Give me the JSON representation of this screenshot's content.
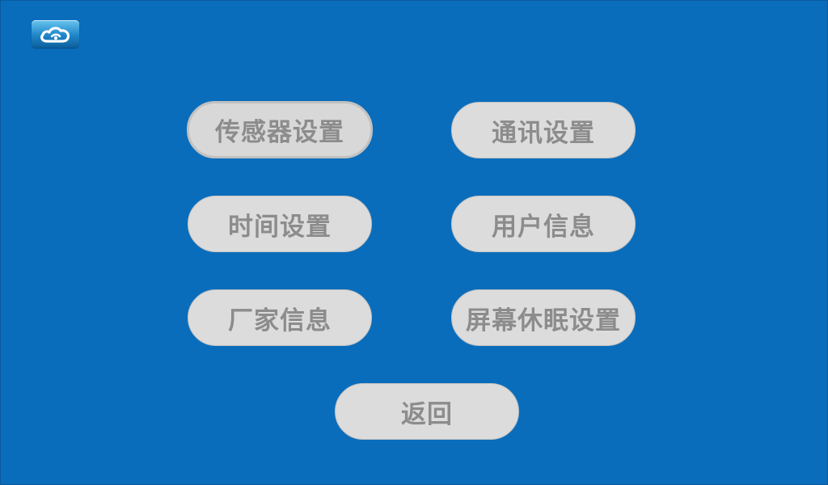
{
  "logo": {
    "icon": "cloud-icon",
    "color": "#1f86c8"
  },
  "background_color": "#0a6dbb",
  "menu": {
    "sensor_settings": "传感器设置",
    "comm_settings": "通讯设置",
    "time_settings": "时间设置",
    "user_info": "用户信息",
    "vendor_info": "厂家信息",
    "screen_sleep_settings": "屏幕休眠设置",
    "back": "返回"
  }
}
